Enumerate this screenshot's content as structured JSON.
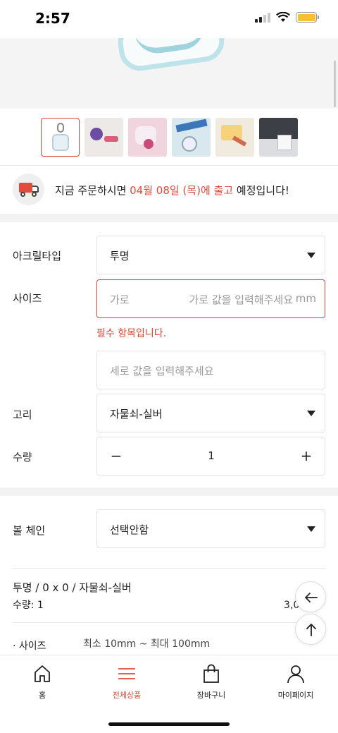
{
  "status": {
    "time": "2:57"
  },
  "shipping": {
    "prefix": "지금 주문하시면 ",
    "date": "04월 08일 (목)에 출고",
    "suffix": " 예정입니다!"
  },
  "options": {
    "acrylic_type": {
      "label": "아크릴타입",
      "value": "투명"
    },
    "size": {
      "label": "사이즈",
      "width_label": "가로",
      "width_placeholder": "가로 값을 입력해주세요",
      "unit": "mm",
      "error": "필수 항목입니다.",
      "height_placeholder": "세로 값을 입력해주세요"
    },
    "ring": {
      "label": "고리",
      "value": "자물쇠-실버"
    },
    "quantity": {
      "label": "수량",
      "minus": "−",
      "value": "1",
      "plus": "+"
    },
    "ball_chain": {
      "label": "볼 체인",
      "value": "선택안함"
    }
  },
  "summary": {
    "name": "투명 / 0 x 0 / 자물쇠-실버",
    "qty": "수량: 1",
    "price": "3,000원"
  },
  "size_info": {
    "label": "· 사이즈",
    "range": "최소 10mm ~ 최대 100mm"
  },
  "nav": {
    "items": [
      {
        "label": "홈",
        "icon": "home-icon"
      },
      {
        "label": "전체상품",
        "icon": "menu-icon",
        "active": true
      },
      {
        "label": "장바구니",
        "icon": "shopping-bag-icon"
      },
      {
        "label": "마이페이지",
        "icon": "user-icon"
      }
    ]
  },
  "colors": {
    "accent": "#e14a3c"
  }
}
